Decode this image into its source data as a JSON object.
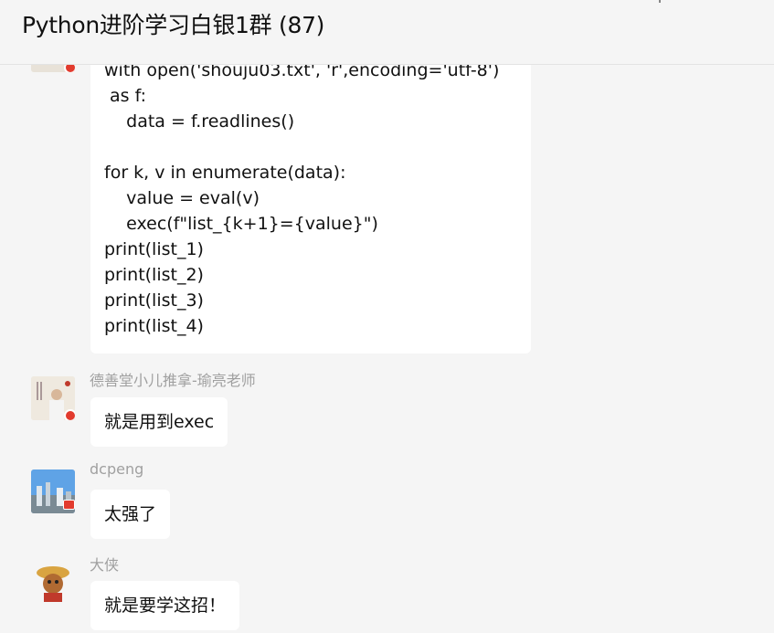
{
  "header": {
    "title": "Python进阶学习白银1群 (87)"
  },
  "messages": [
    {
      "code_lines": [
        "with open('shouju03.txt', 'r',encoding='utf-8')",
        " as f:",
        "    data = f.readlines()",
        "",
        "for k, v in enumerate(data):",
        "    value = eval(v)",
        "    exec(f\"list_{k+1}={value}\")",
        "print(list_1)",
        "print(list_2)",
        "print(list_3)",
        "print(list_4)"
      ]
    },
    {
      "sender": "德善堂小儿推拿-瑜亮老师",
      "text": "就是用到exec"
    },
    {
      "sender": "dcpeng",
      "text": "太强了"
    },
    {
      "sender": "大侠",
      "text": "就是要学这招！"
    }
  ],
  "colors": {
    "background": "#f5f5f5",
    "bubble": "#ffffff",
    "sender_name": "#a0a0a0",
    "flag_red": "#e23b2e"
  },
  "icons": {
    "header_left": "pin-icon",
    "header_right": "window-icon"
  }
}
